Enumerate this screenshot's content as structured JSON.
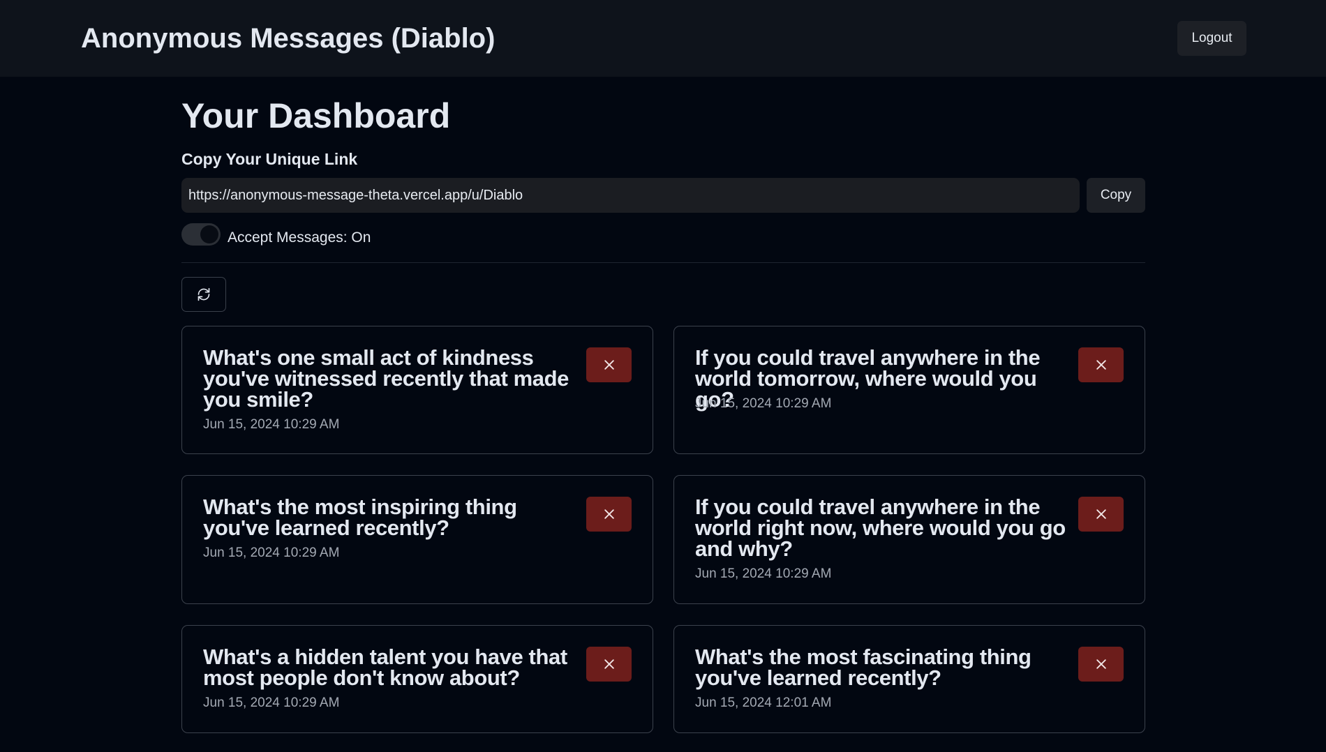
{
  "header": {
    "app_title": "Anonymous Messages (Diablo)",
    "logout_label": "Logout"
  },
  "dashboard": {
    "title": "Your Dashboard",
    "link_heading": "Copy Your Unique Link",
    "link_value": "https://anonymous-message-theta.vercel.app/u/Diablo",
    "copy_label": "Copy",
    "accept_messages_label": "Accept Messages: On",
    "accept_messages_on": true,
    "refresh_icon": "refresh-icon"
  },
  "messages": [
    {
      "content": "What's one small act of kindness you've witnessed recently that made you smile?",
      "date": "Jun 15, 2024 10:29 AM"
    },
    {
      "content": "If you could travel anywhere in the world tomorrow, where would you go?",
      "date": "Jun 15, 2024 10:29 AM"
    },
    {
      "content": "What's the most inspiring thing you've learned recently?",
      "date": "Jun 15, 2024 10:29 AM"
    },
    {
      "content": "If you could travel anywhere in the world right now, where would you go and why?",
      "date": "Jun 15, 2024 10:29 AM"
    },
    {
      "content": "What's a hidden talent you have that most people don't know about?",
      "date": "Jun 15, 2024 10:29 AM"
    },
    {
      "content": "What's the most fascinating thing you've learned recently?",
      "date": "Jun 15, 2024 12:01 AM"
    }
  ],
  "colors": {
    "page_background": "#020711",
    "header_background": "#0e131b",
    "delete_button": "#6c1d1b",
    "card_border": "#3c424d",
    "text": "#e3e8f0",
    "muted_text": "#a3a9b3"
  }
}
